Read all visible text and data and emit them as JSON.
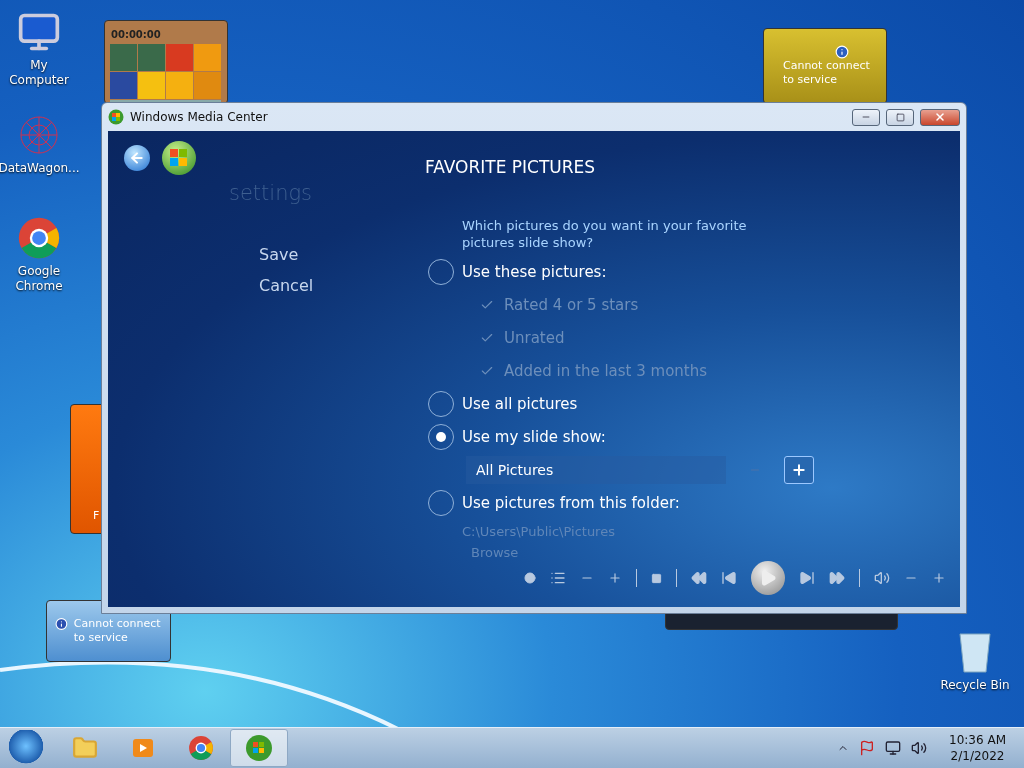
{
  "desktop_icons": [
    {
      "label": "My Computer",
      "kind": "computer"
    },
    {
      "label": "DataWagon...",
      "kind": "network"
    },
    {
      "label": "Google Chrome",
      "kind": "chrome"
    }
  ],
  "recycle_bin": {
    "label": "Recycle Bin"
  },
  "puzzle_gadget": {
    "timer": "00:00:00"
  },
  "notes_gadget": {
    "text": "F"
  },
  "currency_gadget": {
    "message": "Cannot connect to service"
  },
  "weather_gadget": {
    "message": "Cannot connect to service"
  },
  "window": {
    "title": "Windows Media Center",
    "section": "settings",
    "heading": "FAVORITE PICTURES",
    "menu": [
      {
        "label": "Save"
      },
      {
        "label": "Cancel"
      }
    ],
    "question": "Which pictures do you want in your favorite pictures slide show?",
    "options": [
      {
        "kind": "radio",
        "label": "Use these pictures:",
        "selected": false
      },
      {
        "kind": "check",
        "label": "Rated 4 or 5 stars",
        "checked": true,
        "disabled": true
      },
      {
        "kind": "check",
        "label": "Unrated",
        "checked": true,
        "disabled": true
      },
      {
        "kind": "check",
        "label": "Added in the last 3 months",
        "checked": true,
        "disabled": true
      },
      {
        "kind": "radio",
        "label": "Use all pictures",
        "selected": false
      },
      {
        "kind": "radio",
        "label": "Use my slide show:",
        "selected": true
      },
      {
        "kind": "spinner",
        "label": "All Pictures"
      },
      {
        "kind": "radio",
        "label": "Use pictures from this folder:",
        "selected": false
      },
      {
        "kind": "path",
        "label": "C:\\Users\\Public\\Pictures",
        "disabled": true
      },
      {
        "kind": "link",
        "label": "Browse",
        "disabled": true
      }
    ]
  },
  "taskbar": {
    "apps": [
      {
        "kind": "explorer",
        "selected": false
      },
      {
        "kind": "player",
        "selected": false
      },
      {
        "kind": "chrome",
        "selected": false
      },
      {
        "kind": "mediacenter",
        "selected": true
      }
    ],
    "time": "10:36 AM",
    "date": "2/1/2022"
  }
}
